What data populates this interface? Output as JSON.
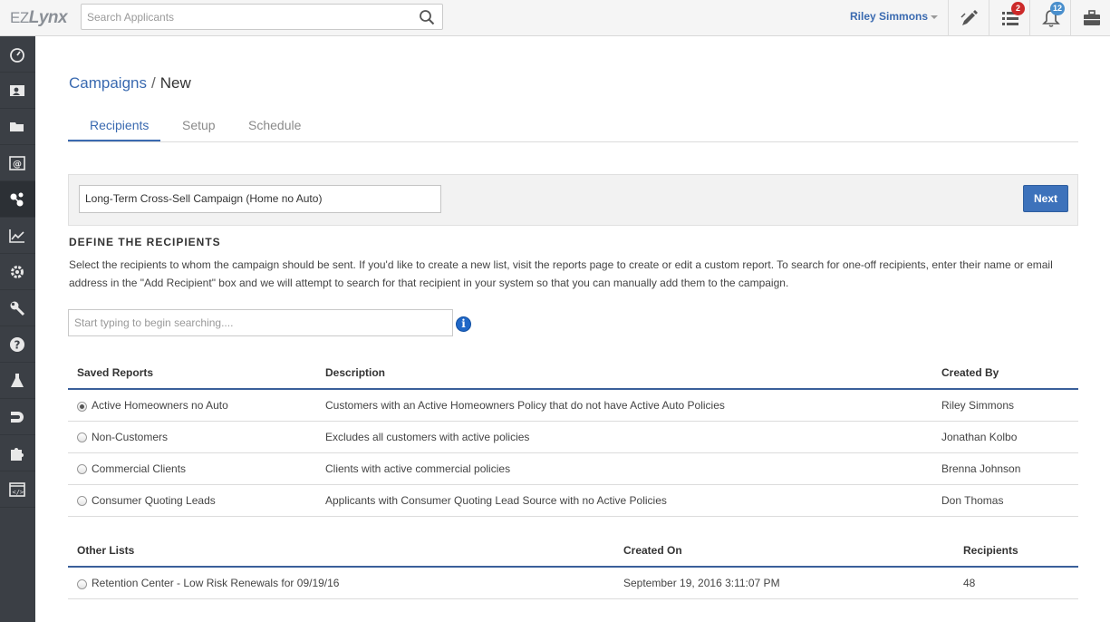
{
  "brand": {
    "logo_prefix": "EZ",
    "logo_suffix": "Lynx"
  },
  "header": {
    "search_placeholder": "Search Applicants",
    "user_name": "Riley Simmons",
    "tasks_badge": "2",
    "notifications_badge": "12"
  },
  "sidebar": {
    "items": [
      {
        "icon": "dashboard-icon"
      },
      {
        "icon": "contacts-icon"
      },
      {
        "icon": "folder-icon"
      },
      {
        "icon": "email-icon"
      },
      {
        "icon": "campaigns-icon",
        "active": true
      },
      {
        "icon": "reports-chart-icon"
      },
      {
        "icon": "settings-gear-icon"
      },
      {
        "icon": "wrench-icon"
      },
      {
        "icon": "help-icon"
      },
      {
        "icon": "lab-flask-icon"
      },
      {
        "icon": "magnet-icon"
      },
      {
        "icon": "puzzle-icon"
      },
      {
        "icon": "code-window-icon"
      }
    ]
  },
  "breadcrumb": {
    "parent": "Campaigns",
    "separator": "/",
    "current": "New"
  },
  "tabs": [
    "Recipients",
    "Setup",
    "Schedule"
  ],
  "campaign": {
    "name": "Long-Term Cross-Sell Campaign (Home no Auto)",
    "next_label": "Next"
  },
  "define": {
    "title": "DEFINE THE RECIPIENTS",
    "description": "Select the recipients to whom the campaign should be sent. If you'd like to create a new list, visit the reports page to create or edit a custom report. To search for one-off recipients, enter their name or email address in the \"Add Recipient\" box and we will attempt to search for that recipient in your system so that you can manually add them to the campaign.",
    "search_placeholder": "Start typing to begin searching...."
  },
  "saved_reports": {
    "headers": [
      "Saved Reports",
      "Description",
      "Created By"
    ],
    "rows": [
      {
        "name": "Active Homeowners no Auto",
        "description": "Customers with an Active Homeowners Policy that do not have Active Auto Policies",
        "created_by": "Riley Simmons",
        "selected": true
      },
      {
        "name": "Non-Customers",
        "description": "Excludes all customers with active policies",
        "created_by": "Jonathan Kolbo",
        "selected": false
      },
      {
        "name": "Commercial Clients",
        "description": "Clients with active commercial policies",
        "created_by": "Brenna Johnson",
        "selected": false
      },
      {
        "name": "Consumer Quoting Leads",
        "description": "Applicants with Consumer Quoting Lead Source with no Active Policies",
        "created_by": "Don Thomas",
        "selected": false
      }
    ]
  },
  "other_lists": {
    "headers": [
      "Other Lists",
      "Created On",
      "Recipients"
    ],
    "rows": [
      {
        "name": "Retention Center - Low Risk Renewals for 09/19/16",
        "created_on": "September 19, 2016 3:11:07 PM",
        "recipients": "48",
        "selected": false
      }
    ]
  },
  "colors": {
    "accent": "#3a6ab0",
    "button": "#3d72bb",
    "sidebar": "#3b3f45"
  }
}
